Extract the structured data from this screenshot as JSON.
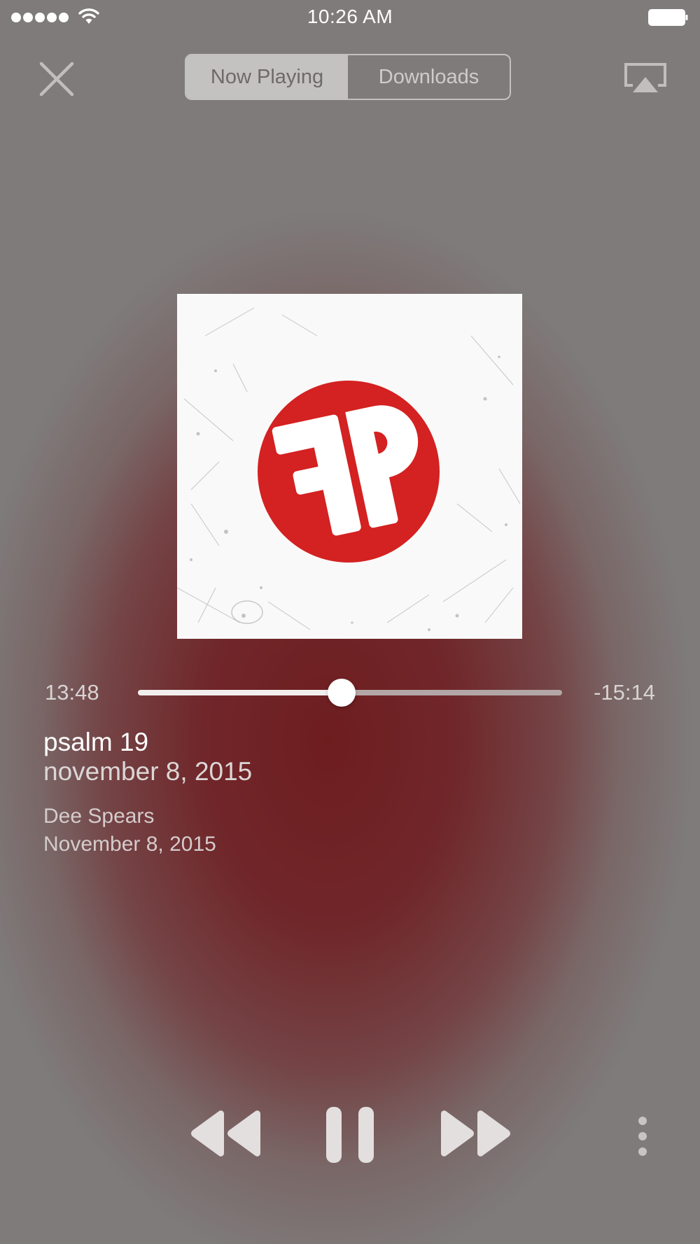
{
  "status_bar": {
    "time": "10:26 AM",
    "signal_icon": "signal-dots-icon",
    "wifi_icon": "wifi-icon",
    "battery_icon": "battery-icon"
  },
  "nav": {
    "close_icon": "close-icon",
    "tabs": [
      {
        "label": "Now Playing",
        "selected": true
      },
      {
        "label": "Downloads",
        "selected": false
      }
    ],
    "airplay_icon": "airplay-icon"
  },
  "artwork": {
    "description_icon": "podcast-logo-fp"
  },
  "playback": {
    "elapsed": "13:48",
    "remaining": "-15:14",
    "progress_fraction": 0.48
  },
  "track": {
    "title": "psalm 19",
    "subtitle": "november 8, 2015",
    "artist": "Dee Spears",
    "date": "November 8, 2015"
  },
  "controls": {
    "rewind_icon": "rewind-icon",
    "pause_icon": "pause-icon",
    "forward_icon": "fast-forward-icon",
    "more_icon": "more-vertical-icon"
  },
  "colors": {
    "background_gray": "#7f7b7b",
    "background_red": "#6e1d1f",
    "logo_red": "#d42121",
    "control_fill": "#e3dfdf"
  }
}
